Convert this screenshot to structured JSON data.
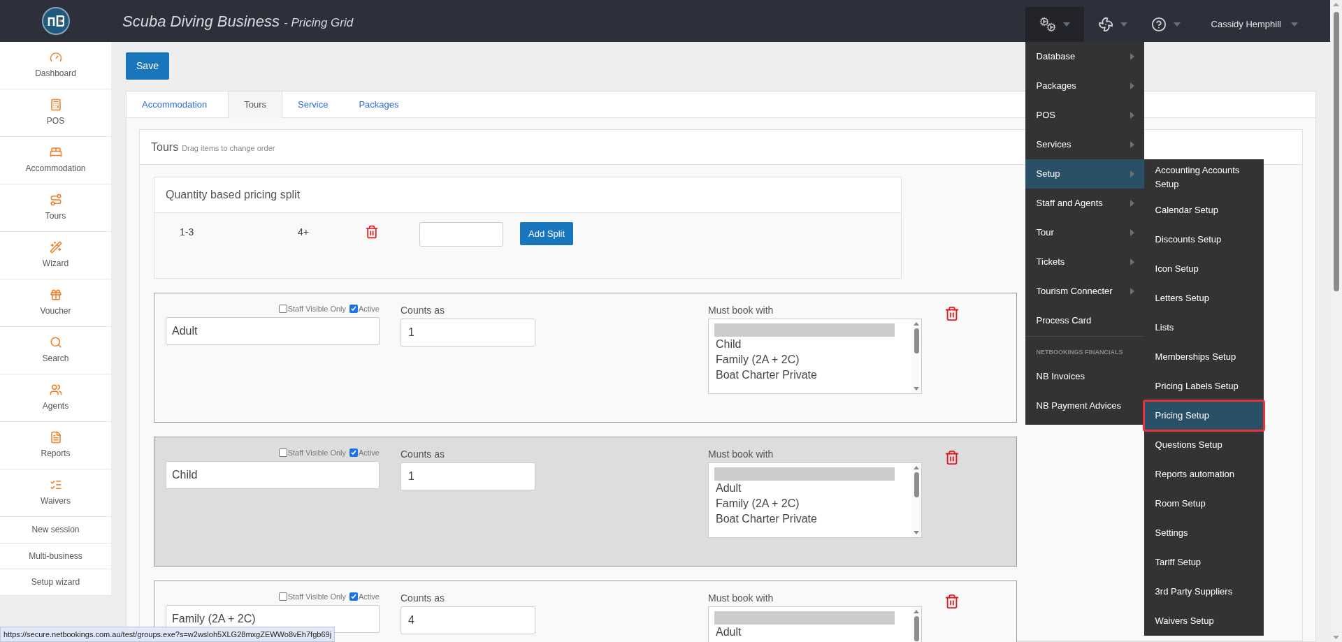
{
  "header": {
    "title": "Scuba Diving Business",
    "subtitle": "- Pricing Grid",
    "user": "Cassidy Hemphill"
  },
  "sidebar": {
    "items": [
      {
        "label": "Dashboard",
        "kind": "icon"
      },
      {
        "label": "POS",
        "kind": "icon"
      },
      {
        "label": "Accommodation",
        "kind": "icon"
      },
      {
        "label": "Tours",
        "kind": "icon"
      },
      {
        "label": "Wizard",
        "kind": "icon"
      },
      {
        "label": "Voucher",
        "kind": "icon"
      },
      {
        "label": "Search",
        "kind": "icon"
      },
      {
        "label": "Agents",
        "kind": "icon"
      },
      {
        "label": "Reports",
        "kind": "icon"
      },
      {
        "label": "Waivers",
        "kind": "icon"
      },
      {
        "label": "New session",
        "kind": "text"
      },
      {
        "label": "Multi-business",
        "kind": "text"
      },
      {
        "label": "Setup wizard",
        "kind": "text"
      }
    ]
  },
  "save_button": "Save",
  "tabs": [
    {
      "label": "Accommodation",
      "selected": false
    },
    {
      "label": "Tours",
      "selected": true
    },
    {
      "label": "Service",
      "selected": false
    },
    {
      "label": "Packages",
      "selected": false
    }
  ],
  "panel": {
    "title": "Tours",
    "hint": "Drag items to change order"
  },
  "split": {
    "title": "Quantity based pricing split",
    "ranges": [
      "1-3",
      "4+"
    ],
    "button": "Add Split"
  },
  "rows": [
    {
      "name": "Adult",
      "highlighted": false,
      "staff_label": "Staff Visible Only",
      "staff_visible_only": false,
      "active_label": "Active",
      "active": true,
      "counts_label": "Counts as",
      "counts_as": "1",
      "must_label": "Must book with",
      "blank_option_selected": true,
      "options": [
        "Child",
        "Family (2A + 2C)",
        "Boat Charter Private"
      ]
    },
    {
      "name": "Child",
      "highlighted": true,
      "staff_label": "Staff Visible Only",
      "staff_visible_only": false,
      "active_label": "Active",
      "active": true,
      "counts_label": "Counts as",
      "counts_as": "1",
      "must_label": "Must book with",
      "blank_option_selected": true,
      "options": [
        "Adult",
        "Family (2A + 2C)",
        "Boat Charter Private"
      ]
    },
    {
      "name": "Family (2A + 2C)",
      "highlighted": false,
      "staff_label": "Staff Visible Only",
      "staff_visible_only": false,
      "active_label": "Active",
      "active": true,
      "counts_label": "Counts as",
      "counts_as": "4",
      "must_label": "Must book with",
      "blank_option_selected": true,
      "options": [
        "Adult"
      ]
    }
  ],
  "settings_menu": {
    "items": [
      {
        "kind": "item",
        "label": "Database",
        "submenu": true,
        "selected": false
      },
      {
        "kind": "item",
        "label": "Packages",
        "submenu": true,
        "selected": false
      },
      {
        "kind": "item",
        "label": "POS",
        "submenu": true,
        "selected": false
      },
      {
        "kind": "item",
        "label": "Services",
        "submenu": true,
        "selected": false
      },
      {
        "kind": "item",
        "label": "Setup",
        "submenu": true,
        "selected": true
      },
      {
        "kind": "item",
        "label": "Staff and Agents",
        "submenu": true,
        "selected": false
      },
      {
        "kind": "item",
        "label": "Tour",
        "submenu": true,
        "selected": false
      },
      {
        "kind": "item",
        "label": "Tickets",
        "submenu": true,
        "selected": false
      },
      {
        "kind": "item",
        "label": "Tourism Connecter",
        "submenu": true,
        "selected": false
      },
      {
        "kind": "item",
        "label": "Process Card",
        "submenu": false,
        "selected": false
      },
      {
        "kind": "header",
        "label": "NETBOOKINGS FINANCIALS"
      },
      {
        "kind": "item",
        "label": "NB Invoices",
        "submenu": false,
        "selected": false
      },
      {
        "kind": "item",
        "label": "NB Payment Advices",
        "submenu": false,
        "selected": false
      }
    ]
  },
  "setup_submenu": {
    "items": [
      {
        "label": "Accounting Accounts Setup",
        "selected": false,
        "outlined": false
      },
      {
        "label": "Calendar Setup",
        "selected": false,
        "outlined": false
      },
      {
        "label": "Discounts Setup",
        "selected": false,
        "outlined": false
      },
      {
        "label": "Icon Setup",
        "selected": false,
        "outlined": false
      },
      {
        "label": "Letters Setup",
        "selected": false,
        "outlined": false
      },
      {
        "label": "Lists",
        "selected": false,
        "outlined": false
      },
      {
        "label": "Memberships Setup",
        "selected": false,
        "outlined": false
      },
      {
        "label": "Pricing Labels Setup",
        "selected": false,
        "outlined": false
      },
      {
        "label": "Pricing Setup",
        "selected": true,
        "outlined": true
      },
      {
        "label": "Questions Setup",
        "selected": false,
        "outlined": false
      },
      {
        "label": "Reports automation",
        "selected": false,
        "outlined": false
      },
      {
        "label": "Room Setup",
        "selected": false,
        "outlined": false
      },
      {
        "label": "Settings",
        "selected": false,
        "outlined": false
      },
      {
        "label": "Tariff Setup",
        "selected": false,
        "outlined": false
      },
      {
        "label": "3rd Party Suppliers",
        "selected": false,
        "outlined": false
      },
      {
        "label": "Waivers Setup",
        "selected": false,
        "outlined": false
      }
    ]
  },
  "status_bar": {
    "url": "https://secure.netbookings.com.au/test/groups.exe?s=w2wsloh5XLG28mxgZEWWo8vEh7fgb69j"
  }
}
